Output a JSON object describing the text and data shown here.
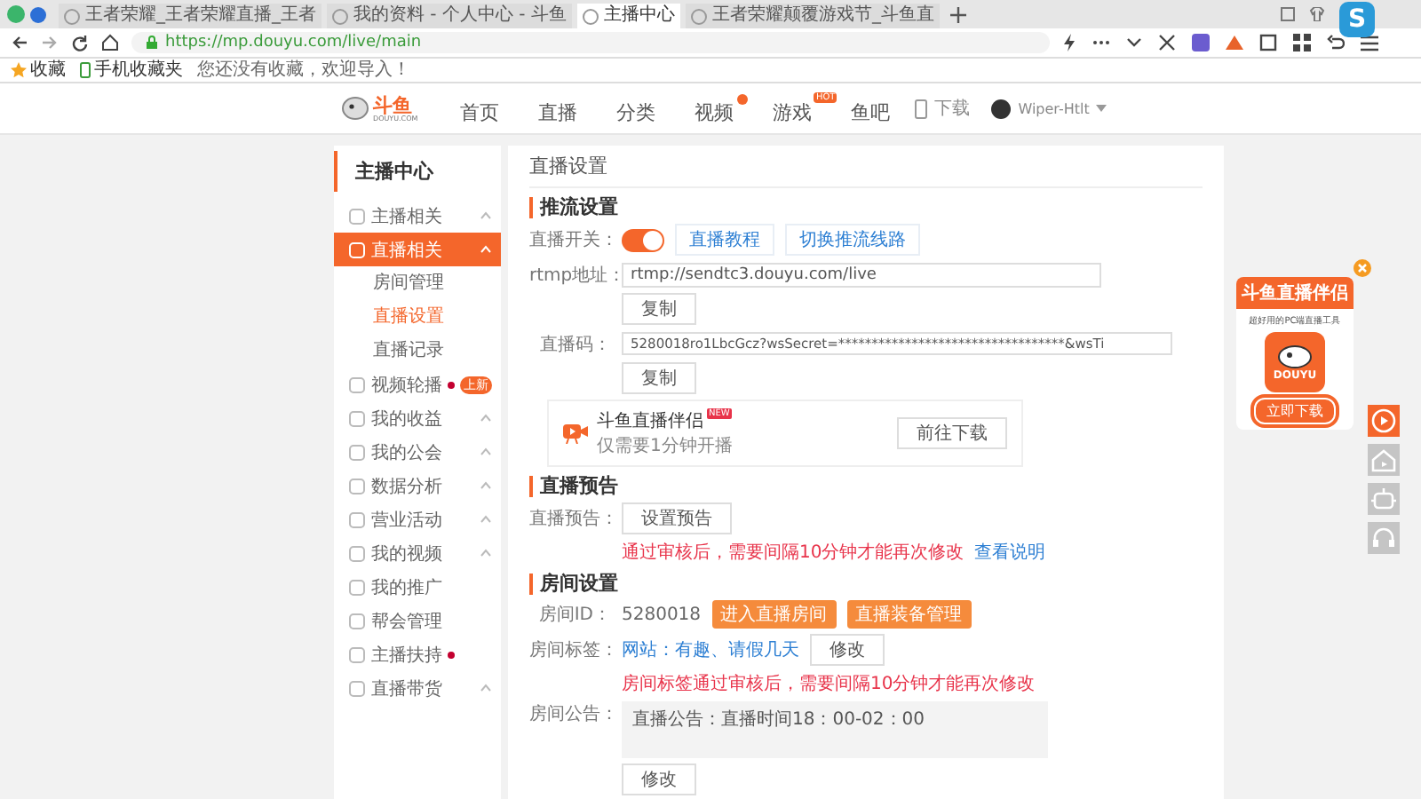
{
  "browser": {
    "tabs": [
      {
        "title": "王者荣耀_王者荣耀直播_王者",
        "selected": false
      },
      {
        "title": "我的资料 - 个人中心 - 斗鱼",
        "selected": false
      },
      {
        "title": "主播中心",
        "selected": true
      },
      {
        "title": "王者荣耀颠覆游戏节_斗鱼直",
        "selected": false
      }
    ],
    "address": "https://mp.douyu.com/live/main",
    "bookmarks": [
      {
        "label": "收藏",
        "kind": "star"
      },
      {
        "label": "手机收藏夹",
        "kind": "phone"
      },
      {
        "label": "您还没有收藏，欢迎导入！",
        "kind": "text"
      }
    ],
    "overlay_logo": "S"
  },
  "site_header": {
    "logo": {
      "name": "斗鱼",
      "domain": "DOUYU.COM"
    },
    "nav": [
      {
        "label": "首页",
        "dot": false
      },
      {
        "label": "直播",
        "dot": false
      },
      {
        "label": "分类",
        "dot": false
      },
      {
        "label": "视频",
        "dot": true
      },
      {
        "label": "游戏",
        "dot": false,
        "badge": "HOT"
      },
      {
        "label": "鱼吧",
        "dot": false
      }
    ],
    "download": "下载",
    "user": "Wiper-Htlt"
  },
  "sidebar": {
    "title": "主播中心",
    "items": [
      {
        "label": "主播相关",
        "expandable": true,
        "expanded": false,
        "selected": false,
        "dot": false
      },
      {
        "label": "直播相关",
        "expandable": true,
        "expanded": true,
        "selected": true,
        "dot": false,
        "children": [
          {
            "label": "房间管理",
            "selected": false
          },
          {
            "label": "直播设置",
            "selected": true
          },
          {
            "label": "直播记录",
            "selected": false
          }
        ]
      },
      {
        "label": "视频轮播",
        "expandable": false,
        "selected": false,
        "dot": true,
        "badge": "上新"
      },
      {
        "label": "我的收益",
        "expandable": true,
        "expanded": false,
        "selected": false,
        "dot": false
      },
      {
        "label": "我的公会",
        "expandable": true,
        "expanded": false,
        "selected": false,
        "dot": false
      },
      {
        "label": "数据分析",
        "expandable": true,
        "expanded": false,
        "selected": false,
        "dot": false
      },
      {
        "label": "营业活动",
        "expandable": true,
        "expanded": false,
        "selected": false,
        "dot": false
      },
      {
        "label": "我的视频",
        "expandable": true,
        "expanded": false,
        "selected": false,
        "dot": false
      },
      {
        "label": "我的推广",
        "expandable": false,
        "selected": false,
        "dot": false
      },
      {
        "label": "帮会管理",
        "expandable": false,
        "selected": false,
        "dot": false
      },
      {
        "label": "主播扶持",
        "expandable": false,
        "selected": false,
        "dot": true
      },
      {
        "label": "直播带货",
        "expandable": true,
        "expanded": false,
        "selected": false,
        "dot": false
      }
    ]
  },
  "main": {
    "title": "直播设置",
    "stream": {
      "heading": "推流设置",
      "switch": {
        "label": "直播开关：",
        "on": true
      },
      "links": [
        "直播教程",
        "切换推流线路"
      ],
      "rtmp": {
        "label": "rtmp地址：",
        "value": "rtmp://sendtc3.douyu.com/live",
        "button": "复制"
      },
      "code": {
        "label": "直播码：",
        "value": "5280018ro1LbcGcz?wsSecret=**********************************&wsTi",
        "button": "复制"
      },
      "promo": {
        "title": "斗鱼直播伴侣",
        "badge": "NEW",
        "subtitle": "仅需要1分钟开播",
        "button": "前往下载"
      }
    },
    "preview": {
      "heading": "直播预告",
      "label": "直播预告：",
      "button": "设置预告",
      "note": "通过审核后，需要间隔10分钟才能再次修改",
      "link": "查看说明"
    },
    "room": {
      "heading": "房间设置",
      "id_label": "房间ID：",
      "id": "5280018",
      "buttons": [
        "进入直播房间",
        "直播装备管理"
      ],
      "tag_label": "房间标签：",
      "tags": "网站：有趣、请假几天",
      "tag_button": "修改",
      "tag_note": "房间标签通过审核后，需要间隔10分钟才能再次修改",
      "notice_label": "房间公告：",
      "notice": "直播公告：直播时间18：00-02：00",
      "notice_button": "修改"
    }
  },
  "side_ad": {
    "title": "斗鱼直播伴侣",
    "subtitle": "超好用的PC端直播工具",
    "logo": "DOUYU",
    "button": "立即下载"
  },
  "float_tools": [
    {
      "selected": true
    },
    {
      "selected": false
    },
    {
      "selected": false
    },
    {
      "selected": false
    }
  ]
}
